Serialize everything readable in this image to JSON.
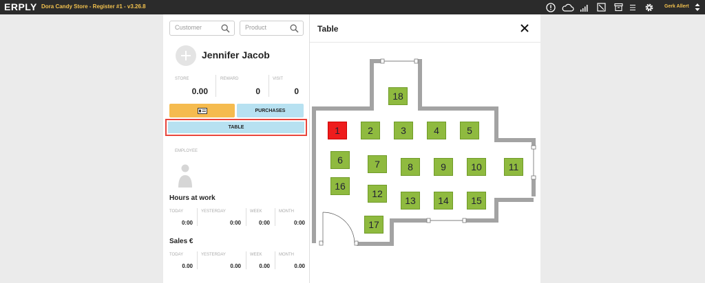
{
  "app": {
    "logo": "ERPLY",
    "store_title": "Dora Candy Store - Register #1 - v3.26.8",
    "user_name": "Gerk Allert"
  },
  "search": {
    "customer_placeholder": "Customer",
    "product_placeholder": "Product"
  },
  "customer": {
    "name": "Jennifer Jacob",
    "stats": [
      {
        "label": "STORE",
        "value": "0.00"
      },
      {
        "label": "REWARD",
        "value": "0"
      },
      {
        "label": "VISIT",
        "value": "0"
      }
    ]
  },
  "buttons": {
    "purchases": "PURCHASES",
    "table": "TABLE"
  },
  "employee": {
    "label": "EMPLOYEE"
  },
  "hours": {
    "title": "Hours at work",
    "cols": [
      {
        "label": "TODAY",
        "value": "0:00"
      },
      {
        "label": "YESTERDAY",
        "value": "0:00"
      },
      {
        "label": "WEEK",
        "value": "0:00"
      },
      {
        "label": "MONTH",
        "value": "0:00"
      }
    ]
  },
  "sales": {
    "title": "Sales €",
    "cols": [
      {
        "label": "TODAY",
        "value": "0.00"
      },
      {
        "label": "YESTERDAY",
        "value": "0.00"
      },
      {
        "label": "WEEK",
        "value": "0.00"
      },
      {
        "label": "MONTH",
        "value": "0.00"
      }
    ]
  },
  "modal": {
    "title": "Table",
    "active_table": "1",
    "tables": [
      "1",
      "2",
      "3",
      "4",
      "5",
      "6",
      "7",
      "8",
      "9",
      "10",
      "11",
      "12",
      "13",
      "14",
      "15",
      "16",
      "17",
      "18"
    ]
  },
  "colors": {
    "topbar": "#2b2b2b",
    "accent_yellow": "#f5bb4f",
    "accent_blue": "#b7e1f1",
    "table_green": "#8fba3f",
    "table_active": "#ee1c1c",
    "highlight": "#e8453c"
  }
}
